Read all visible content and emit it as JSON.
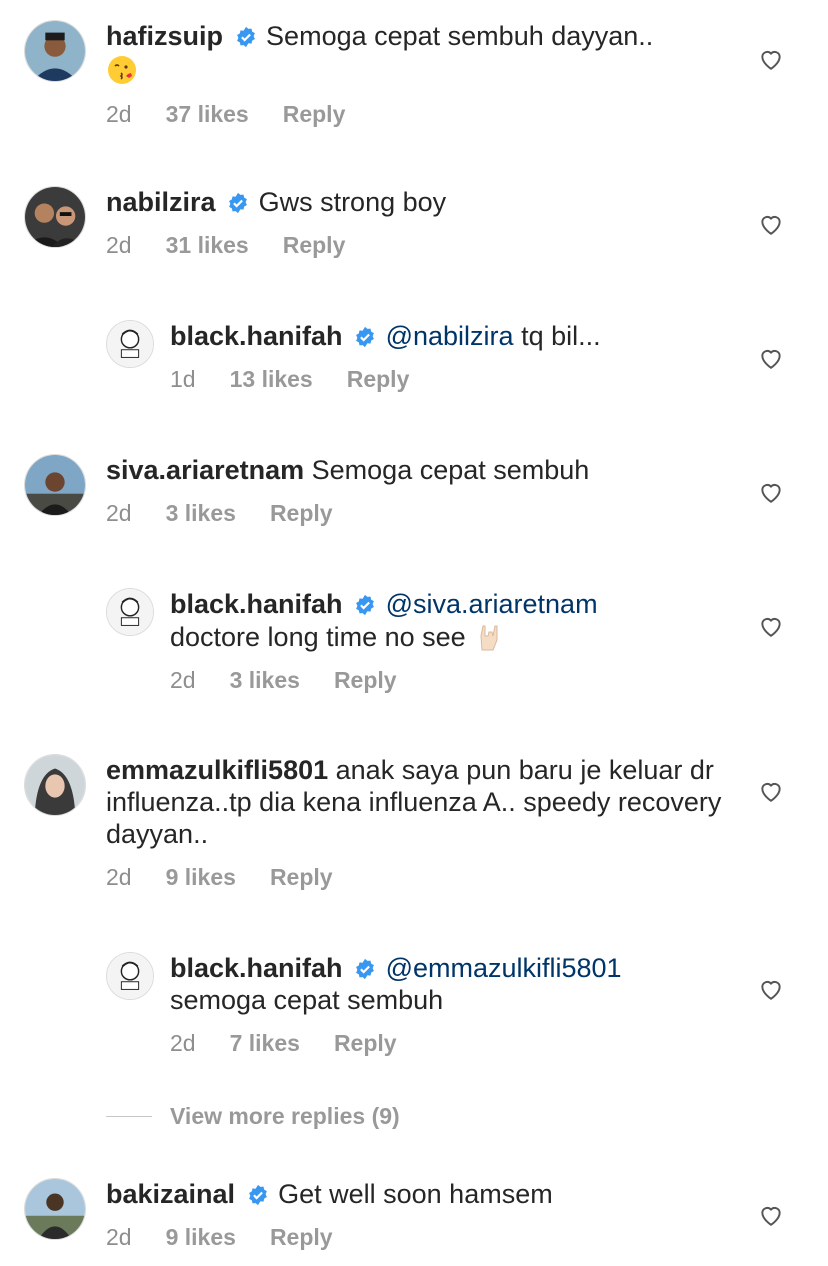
{
  "comments": [
    {
      "user": "hafizsuip",
      "text": "Semoga cepat sembuh dayyan..",
      "emoji": "kissing-face-emoji",
      "time": "2d",
      "likes": "37 likes",
      "reply": "Reply"
    },
    {
      "user": "nabilzira",
      "text": "Gws strong boy",
      "time": "2d",
      "likes": "31 likes",
      "reply": "Reply"
    },
    {
      "user": "black.hanifah",
      "mention": "@nabilzira",
      "text": "tq bil...",
      "time": "1d",
      "likes": "13 likes",
      "reply": "Reply"
    },
    {
      "user": "siva.ariaretnam",
      "text": "Semoga cepat sembuh",
      "time": "2d",
      "likes": "3 likes",
      "reply": "Reply"
    },
    {
      "user": "black.hanifah",
      "mention": "@siva.ariaretnam",
      "text": "doctore long time no see",
      "emoji": "rock-hand-emoji",
      "time": "2d",
      "likes": "3 likes",
      "reply": "Reply"
    },
    {
      "user": "emmazulkifli5801",
      "text": "anak saya pun baru je keluar dr influenza..tp dia kena influenza A.. speedy recovery dayyan..",
      "time": "2d",
      "likes": "9 likes",
      "reply": "Reply"
    },
    {
      "user": "black.hanifah",
      "mention": "@emmazulkifli5801",
      "text": "semoga cepat sembuh",
      "time": "2d",
      "likes": "7 likes",
      "reply": "Reply"
    },
    {
      "user": "bakizainal",
      "text": "Get well soon hamsem",
      "time": "2d",
      "likes": "9 likes",
      "reply": "Reply"
    }
  ],
  "view_more": "View more replies (9)",
  "colors": {
    "verified": "#3897f0",
    "mention": "#003569",
    "meta": "#8e8e8e"
  }
}
